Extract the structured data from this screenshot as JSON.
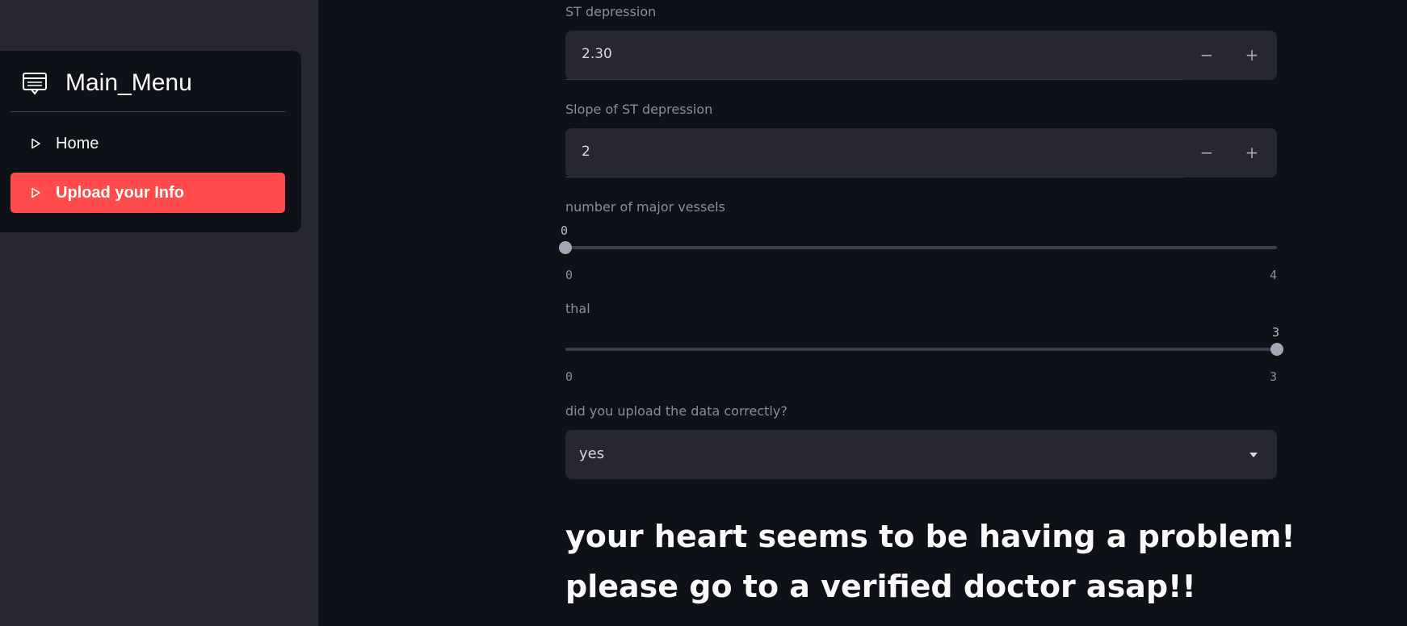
{
  "sidebar": {
    "menu_title": "Main_Menu",
    "menu_icon": "menu-card-icon",
    "items": [
      {
        "label": "Home",
        "icon": "triangle-right-icon",
        "active": false
      },
      {
        "label": "Upload your Info",
        "icon": "triangle-right-icon",
        "active": true
      }
    ],
    "accent_color": "#ff4b4b"
  },
  "form": {
    "st_depression": {
      "label": "ST depression",
      "value": "2.30",
      "minus": "−",
      "plus": "+"
    },
    "slope": {
      "label": "Slope of ST depression",
      "value": "2",
      "minus": "−",
      "plus": "+"
    },
    "vessels": {
      "label": "number of major vessels",
      "value": 0,
      "current": "0",
      "min": "0",
      "max": "4"
    },
    "thal": {
      "label": "thal",
      "value": 3,
      "current": "3",
      "min": "0",
      "max": "3"
    },
    "confirm": {
      "label": "did you upload the data correctly?",
      "selected": "yes"
    }
  },
  "result": {
    "line1": "your heart seems to be having a problem!",
    "line2": "please go to a verified doctor asap!!"
  }
}
